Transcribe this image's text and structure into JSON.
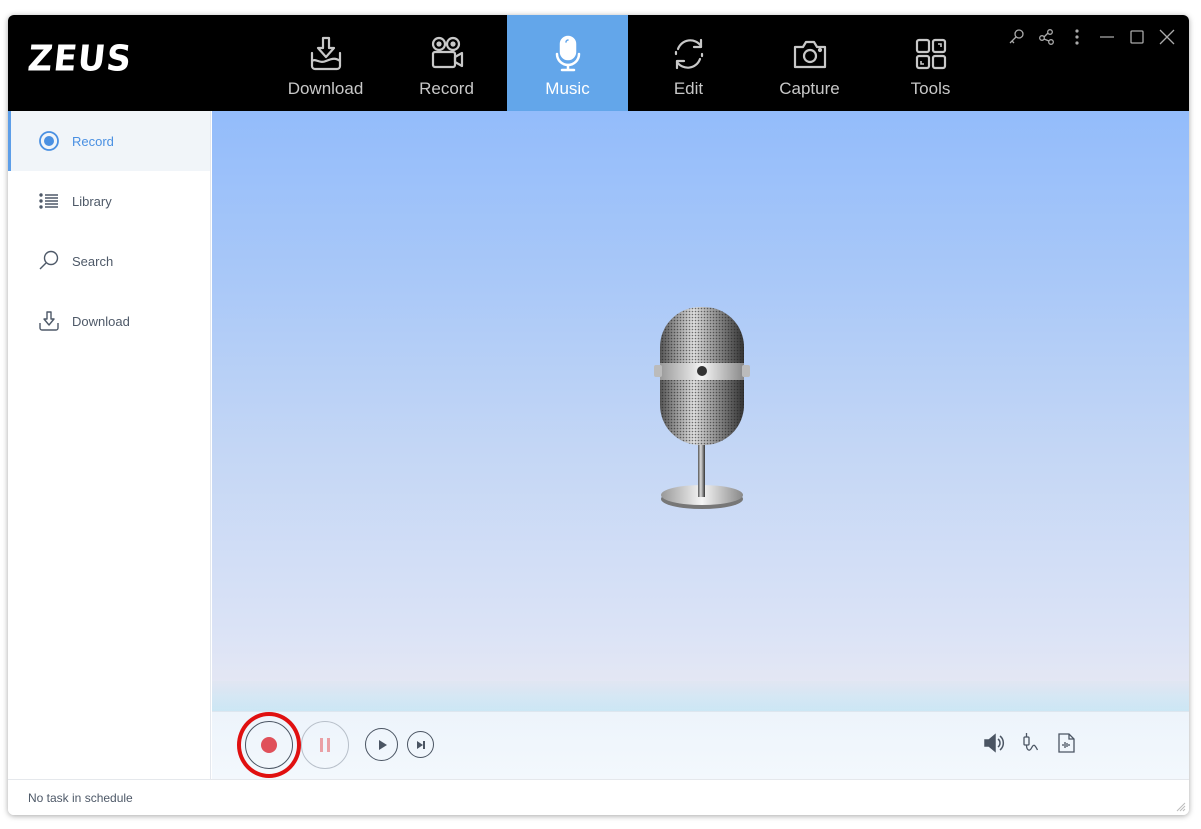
{
  "app": {
    "title": "ZEUS"
  },
  "nav": {
    "items": [
      {
        "label": "Download",
        "icon": "download-tray-icon",
        "active": false
      },
      {
        "label": "Record",
        "icon": "video-camera-icon",
        "active": false
      },
      {
        "label": "Music",
        "icon": "microphone-icon",
        "active": true
      },
      {
        "label": "Edit",
        "icon": "refresh-cycle-icon",
        "active": false
      },
      {
        "label": "Capture",
        "icon": "camera-icon",
        "active": false
      },
      {
        "label": "Tools",
        "icon": "tools-grid-icon",
        "active": false
      }
    ],
    "active_color": "#63a6ea"
  },
  "window_controls": [
    "key-icon",
    "share-icon",
    "more-vertical-icon",
    "minimize-icon",
    "maximize-icon",
    "close-icon"
  ],
  "sidebar": {
    "items": [
      {
        "label": "Record",
        "icon": "radio-record-icon",
        "active": true
      },
      {
        "label": "Library",
        "icon": "list-icon",
        "active": false
      },
      {
        "label": "Search",
        "icon": "search-icon",
        "active": false
      },
      {
        "label": "Download",
        "icon": "download-icon",
        "active": false
      }
    ],
    "active_color": "#4a90e2"
  },
  "player": {
    "record_color": "#e0505a",
    "buttons": [
      "record-button",
      "pause-button",
      "play-button",
      "next-button"
    ],
    "tools": [
      "volume-icon",
      "audio-source-icon",
      "audio-file-icon"
    ]
  },
  "status": {
    "text": "No task in schedule"
  }
}
